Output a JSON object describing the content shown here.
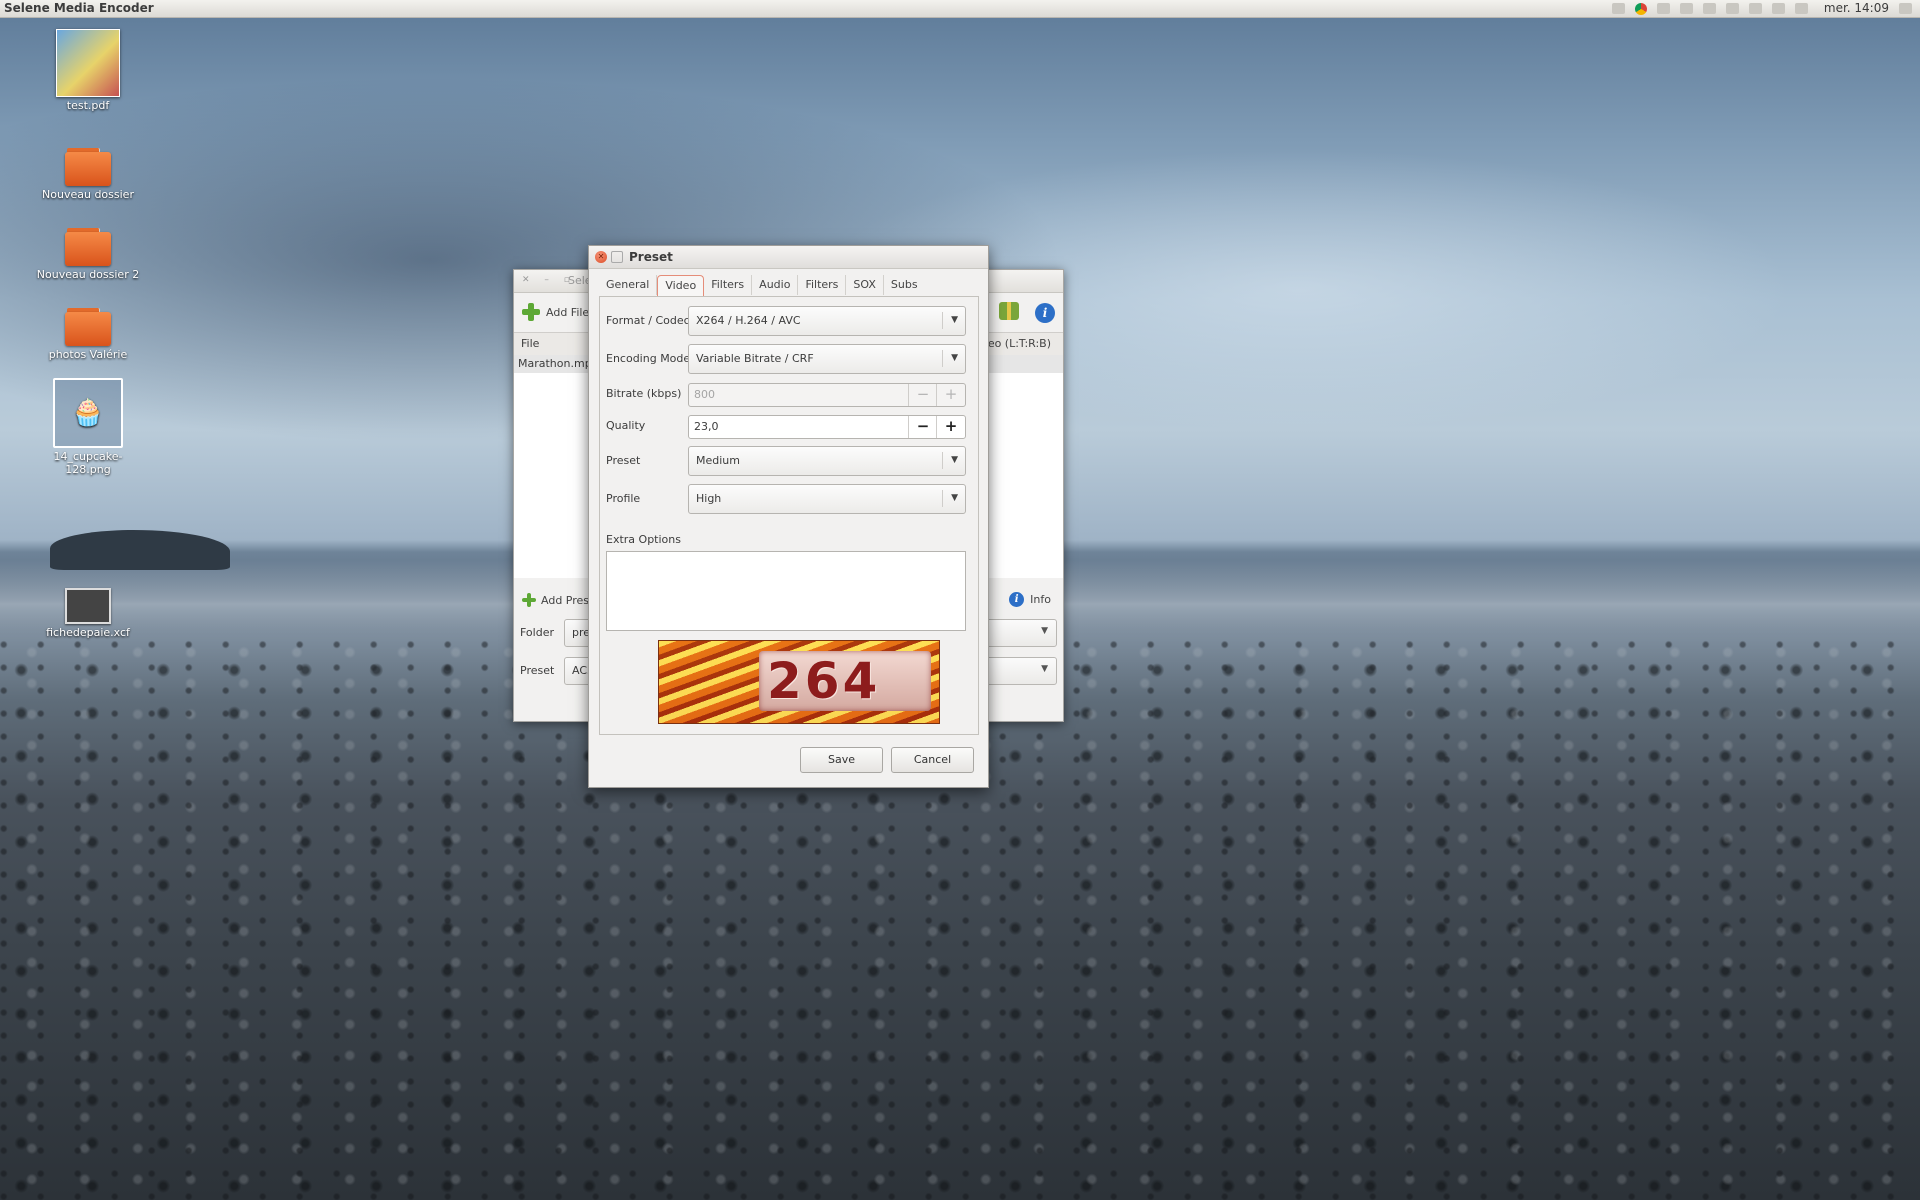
{
  "top_panel": {
    "title": "Selene Media Encoder",
    "clock": "mer. 14:09"
  },
  "desktop_icons": [
    {
      "label": "test.pdf"
    },
    {
      "label": "Nouveau dossier"
    },
    {
      "label": "Nouveau dossier 2"
    },
    {
      "label": "photos Valérie"
    },
    {
      "label": "14_cupcake-128.png"
    },
    {
      "label": "fichedepaie.xcf"
    }
  ],
  "main_window": {
    "title": "Sele",
    "add_files": "Add File",
    "file_column": "File",
    "video_column": "eo (L:T:R:B)",
    "file_row": "Marathon.mp4",
    "add_preset": "Add Pres",
    "info": "Info",
    "folder_label": "Folder",
    "folder_value": "pres",
    "preset_label": "Preset",
    "preset_value": "AC3"
  },
  "preset_dialog": {
    "title": "Preset",
    "tabs": [
      "General",
      "Video",
      "Filters",
      "Audio",
      "Filters",
      "SOX",
      "Subs"
    ],
    "active_tab": "Video",
    "fields": {
      "format_codec": {
        "label": "Format / Codec",
        "value": "X264 / H.264 / AVC"
      },
      "encoding_mode": {
        "label": "Encoding Mode",
        "value": "Variable Bitrate / CRF"
      },
      "bitrate": {
        "label": "Bitrate (kbps)",
        "value": "800",
        "minus": "−",
        "plus": "+"
      },
      "quality": {
        "label": "Quality",
        "value": "23,0",
        "minus": "−",
        "plus": "+"
      },
      "preset": {
        "label": "Preset",
        "value": "Medium"
      },
      "profile": {
        "label": "Profile",
        "value": "High"
      },
      "extra_options": {
        "label": "Extra Options",
        "value": ""
      }
    },
    "logo_text": "264",
    "save_label": "Save",
    "cancel_label": "Cancel"
  },
  "colors": {
    "accent_tab": "#e58d79",
    "close_button": "#dc4b24",
    "info_blue": "#2d6fc7",
    "add_green": "#5da835"
  },
  "icons": {
    "close": "close-icon",
    "add": "plus-icon",
    "info": "info-icon",
    "dropdown": "chevron-down-icon"
  }
}
